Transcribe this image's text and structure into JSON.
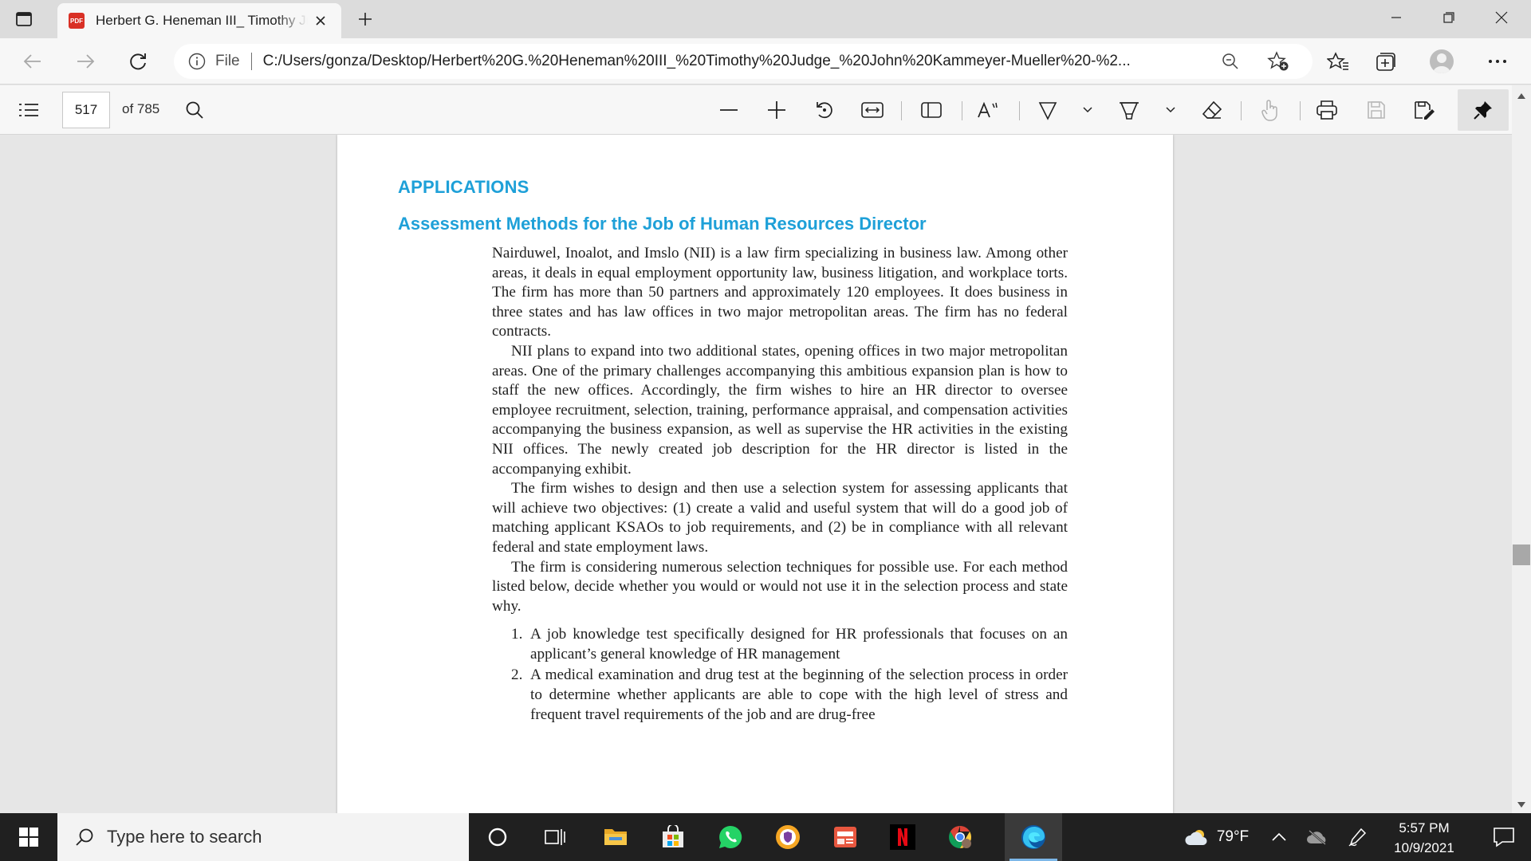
{
  "browser": {
    "tab": {
      "badge": "PDF",
      "title": "Herbert G. Heneman III_ Timothy Judge_ John Kammeyer-Mueller"
    },
    "address": {
      "scheme_label": "File",
      "url": "C:/Users/gonza/Desktop/Herbert%20G.%20Heneman%20III_%20Timothy%20Judge_%20John%20Kammeyer-Mueller%20-%2..."
    }
  },
  "pdf_toolbar": {
    "current_page": "517",
    "page_count": "of 785"
  },
  "document": {
    "heading": "APPLICATIONS",
    "subheading": "Assessment Methods for the Job of Human Resources Director",
    "paragraphs": [
      "Nairduwel, Inoalot, and Imslo (NII) is a law firm specializing in business law. Among other areas, it deals in equal employment opportunity law, business litigation, and workplace torts. The firm has more than 50 partners and approximately 120 employees. It does business in three states and has law offices in two major metropolitan areas. The firm has no federal contracts.",
      "NII plans to expand into two additional states, opening offices in two major metropolitan areas. One of the primary challenges accompanying this ambitious expansion plan is how to staff the new offices. Accordingly, the firm wishes to hire an HR director to oversee employee recruitment, selection, training, performance appraisal, and compensation activities accompanying the business expansion, as well as supervise the HR activities in the existing NII offices. The newly created job description for the HR director is listed in the accompanying exhibit.",
      "The firm wishes to design and then use a selection system for assessing applicants that will achieve two objectives: (1) create a valid and useful system that will do a good job of matching applicant KSAOs to job requirements, and (2) be in compliance with all relevant federal and state employment laws.",
      "The firm is considering numerous selection techniques for possible use. For each method listed below, decide whether you would or would not use it in the selection process and state why."
    ],
    "list": [
      {
        "num": "1.",
        "text": "A job knowledge test specifically designed for HR professionals that focuses on an applicant’s general knowledge of HR management"
      },
      {
        "num": "2.",
        "text": "A medical examination and drug test at the beginning of the selection process in order to determine whether applicants are able to cope with the high level of stress and frequent travel requirements of the job and are drug-free"
      }
    ]
  },
  "taskbar": {
    "search_placeholder": "Type here to search",
    "weather": "79°F",
    "time": "5:57 PM",
    "date": "10/9/2021"
  },
  "colors": {
    "heading_accent": "#1ea0d8",
    "edge_accent": "#0078d4"
  }
}
